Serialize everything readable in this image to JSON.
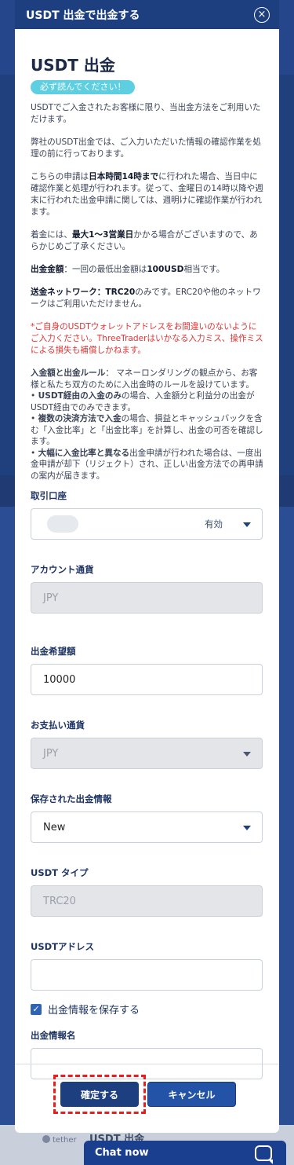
{
  "modal": {
    "title": "USDT 出金で出金する",
    "close": "×",
    "heading": "USDT 出金",
    "badge": "必ず読んでください！",
    "p1": "USDTでご入金されたお客様に限り、当出金方法をご利用いただけます。",
    "p2": "弊社のUSDT出金では、ご入力いただいた情報の確認作業を処理の前に行っております。",
    "p3_a": "こちらの申請は",
    "p3_b": "日本時間14時まで",
    "p3_c": "に行われた場合、当日中に確認作業と処理が行われます。従って、金曜日の14時以降や週末に行われた出金申請に関しては、週明けに確認作業が行われます。",
    "p4_a": "着金には、",
    "p4_b": "最大1～3営業日",
    "p4_c": "かかる場合がございますので、あらかじめご了承ください。",
    "p5_a": "出金金額",
    "p5_b": "：一回の最低出金額は",
    "p5_c": "100USD",
    "p5_d": "相当です。",
    "p6_a": "送金ネットワーク：TRC20",
    "p6_b": "のみです。ERC20や他のネットワークはご利用いただけません。",
    "p7": "*ご自身のUSDTウォレットアドレスをお間違いのないようにご入力ください。ThreeTraderはいかなる入力ミス、操作ミスによる損失も補償しかねます。",
    "r1_a": "入金額と出金ルール",
    "r1_b": "： マネーロンダリングの観点から、お客様と私たち双方のために入出金時のルールを設けています。",
    "r2_a": "•  ",
    "r2_b": "USDT経由の入金のみ",
    "r2_c": "の場合、入金額分と利益分の出金がUSDT経由でのみできます。",
    "r3_a": "•  ",
    "r3_b": "複数の決済方法で入金",
    "r3_c": "の場合、損益とキャッシュバックを含む「入金比率」と「出金比率」を計算し、出金の可否を確認します。",
    "r4_a": "•  ",
    "r4_b": "大幅に入金比率と異なる",
    "r4_c": "出金申請が行われた場合は、一度出金申請が却下（リジェクト）され、正しい出金方法での再申請の案内が届きます。"
  },
  "form": {
    "account_label": "取引口座",
    "account_status": "有効",
    "currency_label": "アカウント通貨",
    "currency_value": "JPY",
    "amount_label": "出金希望額",
    "amount_value": "10000",
    "pay_currency_label": "お支払い通貨",
    "pay_currency_value": "JPY",
    "saved_label": "保存された出金情報",
    "saved_value": "New",
    "usdt_type_label": "USDT タイプ",
    "usdt_type_value": "TRC20",
    "address_label": "USDTアドレス",
    "address_value": "",
    "save_checkbox_label": "出金情報を保存する",
    "info_name_label": "出金情報名",
    "info_name_value": ""
  },
  "buttons": {
    "confirm": "確定する",
    "cancel": "キャンセル"
  },
  "background": {
    "tether": "tether",
    "title": "USDT 出金"
  },
  "chat": {
    "label": "Chat now"
  },
  "colors": {
    "header": "#1d3f80",
    "badge": "#5dcfe0",
    "warning": "#e03434",
    "highlight_border": "#e81e1e"
  }
}
